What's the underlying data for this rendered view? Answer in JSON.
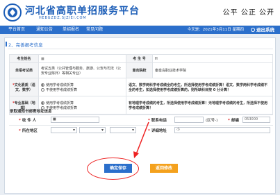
{
  "header": {
    "site_title": "河北省高职单招服务平台",
    "site_url": "HEBGZDZ.SJZIEI.COM",
    "slogan": "公平 公正 公开"
  },
  "nav": {
    "items": [
      "平台首页",
      "通知公告",
      "单招报名",
      "常见问题"
    ],
    "date": "今天是：2021年3月11日 星期四",
    "logout": "退出系统"
  },
  "section": {
    "title": "2、完善报考信息"
  },
  "form": {
    "name_label": "考生姓名",
    "exam_no_label": "考 生 号",
    "exam_no_value": "H",
    "category_label": "单招考试类",
    "category_value": "考试五类（公共管理与服务、旅游、公安与司法（公安专业除外）等相关专业）",
    "school_label": "意向院校",
    "school_value": "秦皇岛职业技术学院",
    "culture_label": "文化素质（语文、数学）",
    "culture_opt1": "使用学考成绩折算",
    "culture_opt2": "不使用学考成绩折算",
    "culture_note": "语文、数学两科学考成绩全的考生，所选择使用学考成绩折算！语文、数学两科学考成绩不全的考生，如选择使用学考成绩折算的，则所缺科目按 0 分计算！",
    "skill_label": "专业基础（地理）",
    "skill_opt1": "使用学考成绩折算",
    "skill_opt2": "不使用学考成绩折算",
    "skill_note": "有地理学考成绩的考生，所选择使用学考成绩折算！无地理学考成绩的考生，所选择不使用学考成绩折算！"
  },
  "address": {
    "title": "录取通知书邮寄地址信息",
    "receiver_label": "收 件 人",
    "phone_label": "联系电话",
    "phone_hint": "(区号-)",
    "zip_label": "邮编",
    "zip_value": "053000",
    "region_label": "所在地区",
    "detail_label": "详细地址",
    "detail_value": "小"
  },
  "buttons": {
    "save": "确定保存",
    "back": "返回修改"
  },
  "colors": {
    "primary": "#2b6fcb",
    "warning": "#f4a11d",
    "alert": "#e02020"
  }
}
